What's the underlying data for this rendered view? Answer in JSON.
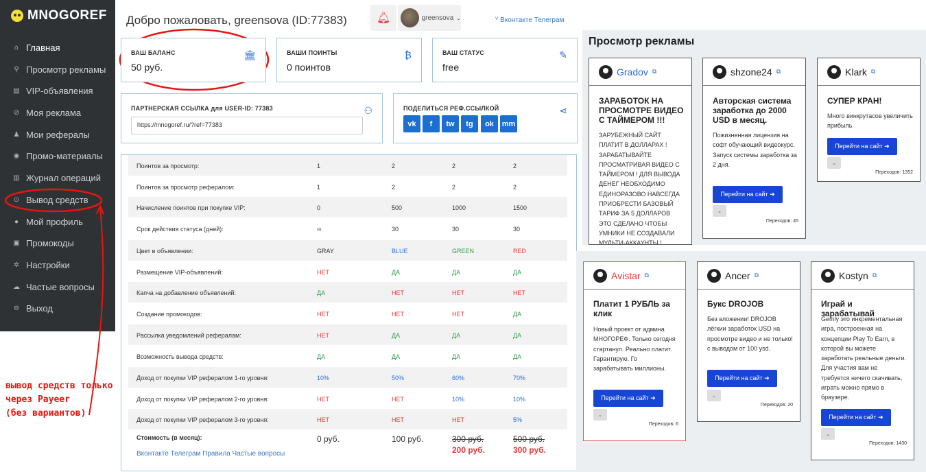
{
  "logo": {
    "text": "MNOGOREF"
  },
  "sidebar": {
    "items": [
      {
        "label": "Главная",
        "icon": "home-icon"
      },
      {
        "label": "Просмотр рекламы",
        "icon": "search-icon"
      },
      {
        "label": "VIP-объявления",
        "icon": "list-icon"
      },
      {
        "label": "Моя реклама",
        "icon": "compass-icon"
      },
      {
        "label": "Мои рефералы",
        "icon": "users-icon"
      },
      {
        "label": "Промо-материалы",
        "icon": "camera-icon"
      },
      {
        "label": "Журнал операций",
        "icon": "book-icon"
      },
      {
        "label": "Вывод средств",
        "icon": "wallet-icon"
      },
      {
        "label": "Мой профиль",
        "icon": "user-icon"
      },
      {
        "label": "Промокоды",
        "icon": "gift-icon"
      },
      {
        "label": "Настройки",
        "icon": "gear-icon"
      },
      {
        "label": "Частые вопросы",
        "icon": "cloud-icon"
      },
      {
        "label": "Выход",
        "icon": "logout-icon"
      }
    ]
  },
  "annotation": {
    "text": "вывод средств только\nчерез Payeer\n(без вариантов)",
    "color": "#e8150f"
  },
  "header": {
    "welcome": "Добро пожаловать, greensova (ID:77383)",
    "username": "greensova",
    "links": "Вконтакте  Телеграм"
  },
  "stats": {
    "balance": {
      "label": "ВАШ БАЛАНС",
      "value": "50 руб."
    },
    "points": {
      "label": "ВАШИ ПОИНТЫ",
      "value": "0 поинтов"
    },
    "status": {
      "label": "ВАШ СТАТУС",
      "value": "free"
    }
  },
  "referral": {
    "label": "ПАРТНЕРСКАЯ ССЫЛКА для USER-ID: 77383",
    "link": "https://mnogoref.ru/?ref=77383"
  },
  "share": {
    "label": "ПОДЕЛИТЬСЯ РЕФ.ССЫЛКОЙ",
    "buttons": [
      "vk",
      "f",
      "tw",
      "tg",
      "ok",
      "mm"
    ]
  },
  "table": {
    "rows": [
      [
        "Поинтов за просмотр:",
        "1",
        "2",
        "2",
        "2"
      ],
      [
        "Поинтов за просмотр рефералом:",
        "1",
        "2",
        "2",
        "2"
      ],
      [
        "Начисление поинтов при покупке VIP:",
        "0",
        "500",
        "1000",
        "1500"
      ],
      [
        "Срок действия статуса (дней):",
        "∞",
        "30",
        "30",
        "30"
      ],
      [
        "Цвет в объявлении:",
        "GRAY",
        "BLUE",
        "GREEN",
        "RED"
      ],
      [
        "Размещение VIP-объявлений:",
        "НЕТ",
        "ДА",
        "ДА",
        "ДА"
      ],
      [
        "Капча на добавление объявлений:",
        "ДА",
        "НЕТ",
        "НЕТ",
        "НЕТ"
      ],
      [
        "Создание промокодов:",
        "НЕТ",
        "НЕТ",
        "НЕТ",
        "ДА"
      ],
      [
        "Рассылка уведомлений рефералам:",
        "НЕТ",
        "ДА",
        "ДА",
        "ДА"
      ],
      [
        "Возможность вывода средств:",
        "ДА",
        "ДА",
        "ДА",
        "ДА"
      ],
      [
        "Доход от покупки VIP рефералом 1-го уровня:",
        "10%",
        "50%",
        "60%",
        "70%"
      ],
      [
        "Доход от покупки VIP рефералом 2-го уровня:",
        "НЕТ",
        "НЕТ",
        "10%",
        "10%"
      ],
      [
        "Доход от покупки VIP рефералом 3-го уровня:",
        "НЕТ",
        "НЕТ",
        "НЕТ",
        "5%"
      ]
    ],
    "price_label": "Стоимость (в месяц):",
    "prices": [
      "0 руб.",
      "100 руб.",
      "300 руб.",
      "500 руб."
    ],
    "discount_prices": [
      "200 руб.",
      "300 руб."
    ],
    "footer": "Вконтакте  Телеграм  Правила  Частые вопросы"
  },
  "ads": {
    "title": "Просмотр рекламы",
    "go_label": "Перейти на сайт ➜",
    "items": [
      {
        "name": "Gradov",
        "title": "ЗАРАБОТОК НА ПРОСМОТРЕ ВИДЕО С ТАЙМЕРОМ !!!",
        "text": "ЗАРУБЕЖНЫЙ САЙТ ПЛАТИТ В ДОЛЛАРАХ ! ЗАРАБАТЫВАЙТЕ ПРОСМАТРИВАЯ ВИДЕО С ТАЙМЕРОМ ! ДЛЯ ВЫВОДА ДЕНЕГ НЕОБХОДИМО ЕДИНОРАЗОВО НАВСЕГДА ПРИОБРЕСТИ БАЗОВЫЙ ТАРИФ ЗА 5 ДОЛЛАРОВ ЭТО СДЕЛАНО ЧТОБЫ УМНИКИ НЕ СОЗДАВАЛИ МУЛЬТИ-АККАУНТЫ !",
        "count": ""
      },
      {
        "name": "shzone24",
        "title": "Авторская система заработка до 2000 USD в месяц.",
        "text": "Пожизненная лицензия на софт обучающий видеокурс. Запуск системы заработка за 2 дня.",
        "count": "Переходов: 45"
      },
      {
        "name": "Klark",
        "title": "СУПЕР КРАН!",
        "text": "Много винкрутасов увеличить прибыль",
        "count": "Переходов: 1352"
      },
      {
        "name": "Avistar",
        "title": "Платит 1 РУБЛЬ за клик",
        "text": "Новый проект от админа МНОГОРЕФ. Только сегодня стартанул. Реально платит. Гарантирую. Го зарабатывать миллионы.",
        "count": "Переходов: 6"
      },
      {
        "name": "Ancer",
        "title": "Букс DROJOB",
        "text": "Без вложении! DROJOB лёгкии заработок USD на просмотре видео и не только! с выводом от 100 ysd.",
        "count": "Переходов: 20"
      },
      {
        "name": "Kostyn",
        "title": "Играй и зарабатывай",
        "text": "Gemly это инкрементальная игра, построенная на концепции Play To Earn, в которой вы можете заработать реальные деньги. Для участия вам не требуется ничего скачивать, играть можно прямо в браузере.",
        "count": "Переходов: 1430"
      }
    ]
  }
}
